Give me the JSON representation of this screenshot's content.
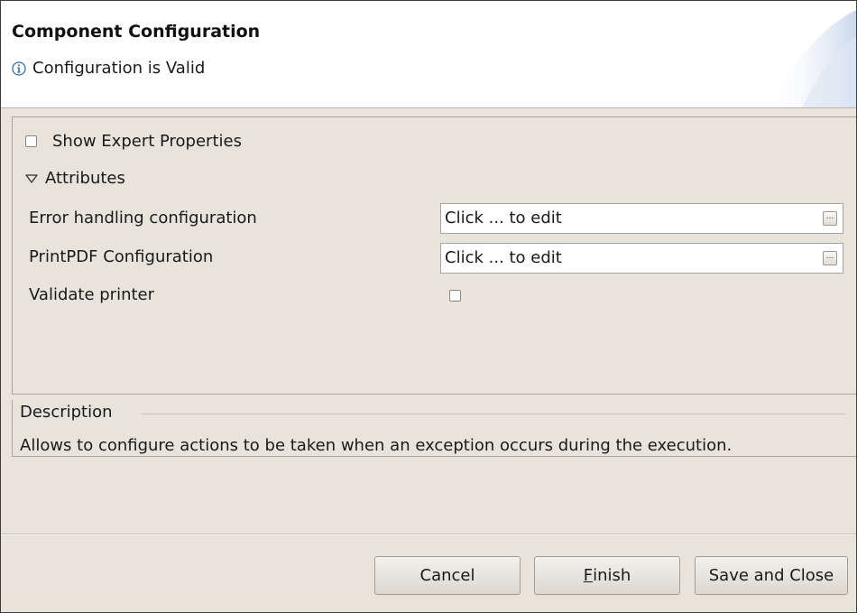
{
  "header": {
    "title": "Component Configuration",
    "message": "Configuration is Valid"
  },
  "options": {
    "show_expert_label": "Show Expert Properties",
    "show_expert_checked": false
  },
  "attributes": {
    "section_label": "Attributes",
    "rows": [
      {
        "label": "Error handling configuration",
        "value": "Click ... to edit",
        "button": "..."
      },
      {
        "label": "PrintPDF Configuration",
        "value": "Click ... to edit",
        "button": "..."
      }
    ],
    "validate_printer_label": "Validate printer",
    "validate_printer_checked": false
  },
  "description": {
    "title": "Description",
    "text": "Allows to configure actions to be taken when an exception occurs during the execution."
  },
  "buttons": {
    "cancel": "Cancel",
    "finish_mnemonic": "F",
    "finish_rest": "inish",
    "save_close": "Save and Close"
  },
  "icons": {
    "info": "info-icon",
    "twisty": "triangle-down-icon"
  },
  "colors": {
    "dialog_bg": "#e8e4dc",
    "banner_bg": "#ffffff",
    "info_blue": "#3a6ea5"
  }
}
